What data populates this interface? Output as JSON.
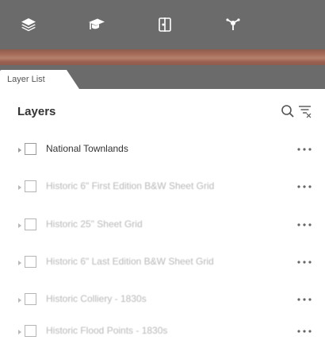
{
  "toolbar": {
    "tools": [
      {
        "icon": "layers-icon"
      },
      {
        "icon": "graduation-cap-icon"
      },
      {
        "icon": "split-view-icon"
      },
      {
        "icon": "network-node-icon"
      }
    ]
  },
  "tab": {
    "label": "Layer List"
  },
  "panel": {
    "title": "Layers",
    "search_icon": "search-icon",
    "filter_icon": "filter-icon"
  },
  "layers": [
    {
      "label": "National Townlands",
      "checked": false,
      "visible_in_scale": true
    },
    {
      "label": "Historic 6\" First Edition B&W Sheet Grid",
      "checked": false,
      "visible_in_scale": false
    },
    {
      "label": "Historic 25\" Sheet Grid",
      "checked": false,
      "visible_in_scale": false
    },
    {
      "label": "Historic 6\" Last Edition B&W Sheet Grid",
      "checked": false,
      "visible_in_scale": false
    },
    {
      "label": "Historic Colliery - 1830s",
      "checked": false,
      "visible_in_scale": false
    },
    {
      "label": "Historic Flood Points - 1830s",
      "checked": false,
      "visible_in_scale": false
    }
  ],
  "colors": {
    "toolbar_bg": "#6b6b6b",
    "brand_strip": "#a66a58",
    "text": "#333333",
    "muted_text": "#b8b8b8"
  }
}
